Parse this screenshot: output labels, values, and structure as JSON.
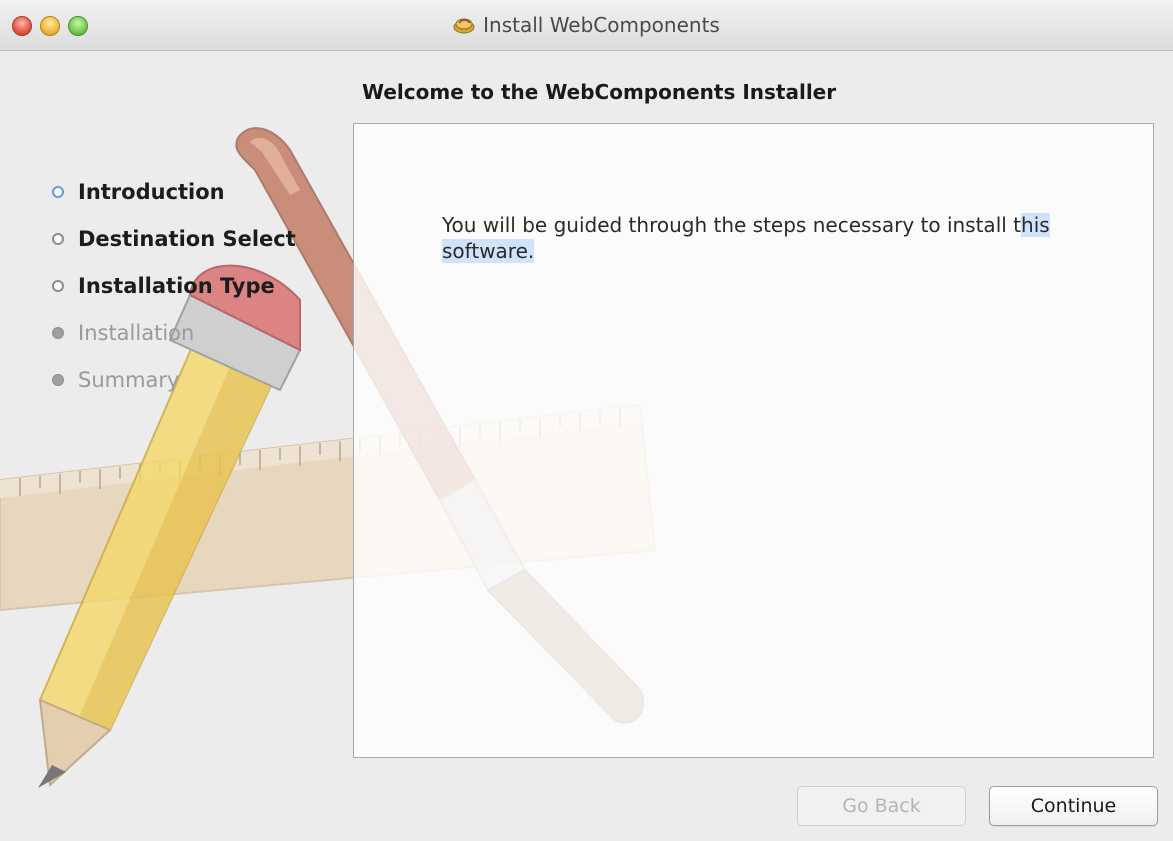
{
  "window": {
    "title": "Install WebComponents"
  },
  "heading": "Welcome to the WebComponents Installer",
  "steps": [
    {
      "label": "Introduction",
      "state": "current"
    },
    {
      "label": "Destination Select",
      "state": "pending"
    },
    {
      "label": "Installation Type",
      "state": "pending"
    },
    {
      "label": "Installation",
      "state": "future"
    },
    {
      "label": "Summary",
      "state": "future"
    }
  ],
  "panel": {
    "text_before_highlight": "You will be guided through the steps necessary to install t",
    "text_highlighted": "his software."
  },
  "buttons": {
    "back_label": "Go Back",
    "continue_label": "Continue"
  },
  "icons": {
    "title_icon": "package-icon",
    "art": "pencil-ruler-brush-artwork"
  }
}
